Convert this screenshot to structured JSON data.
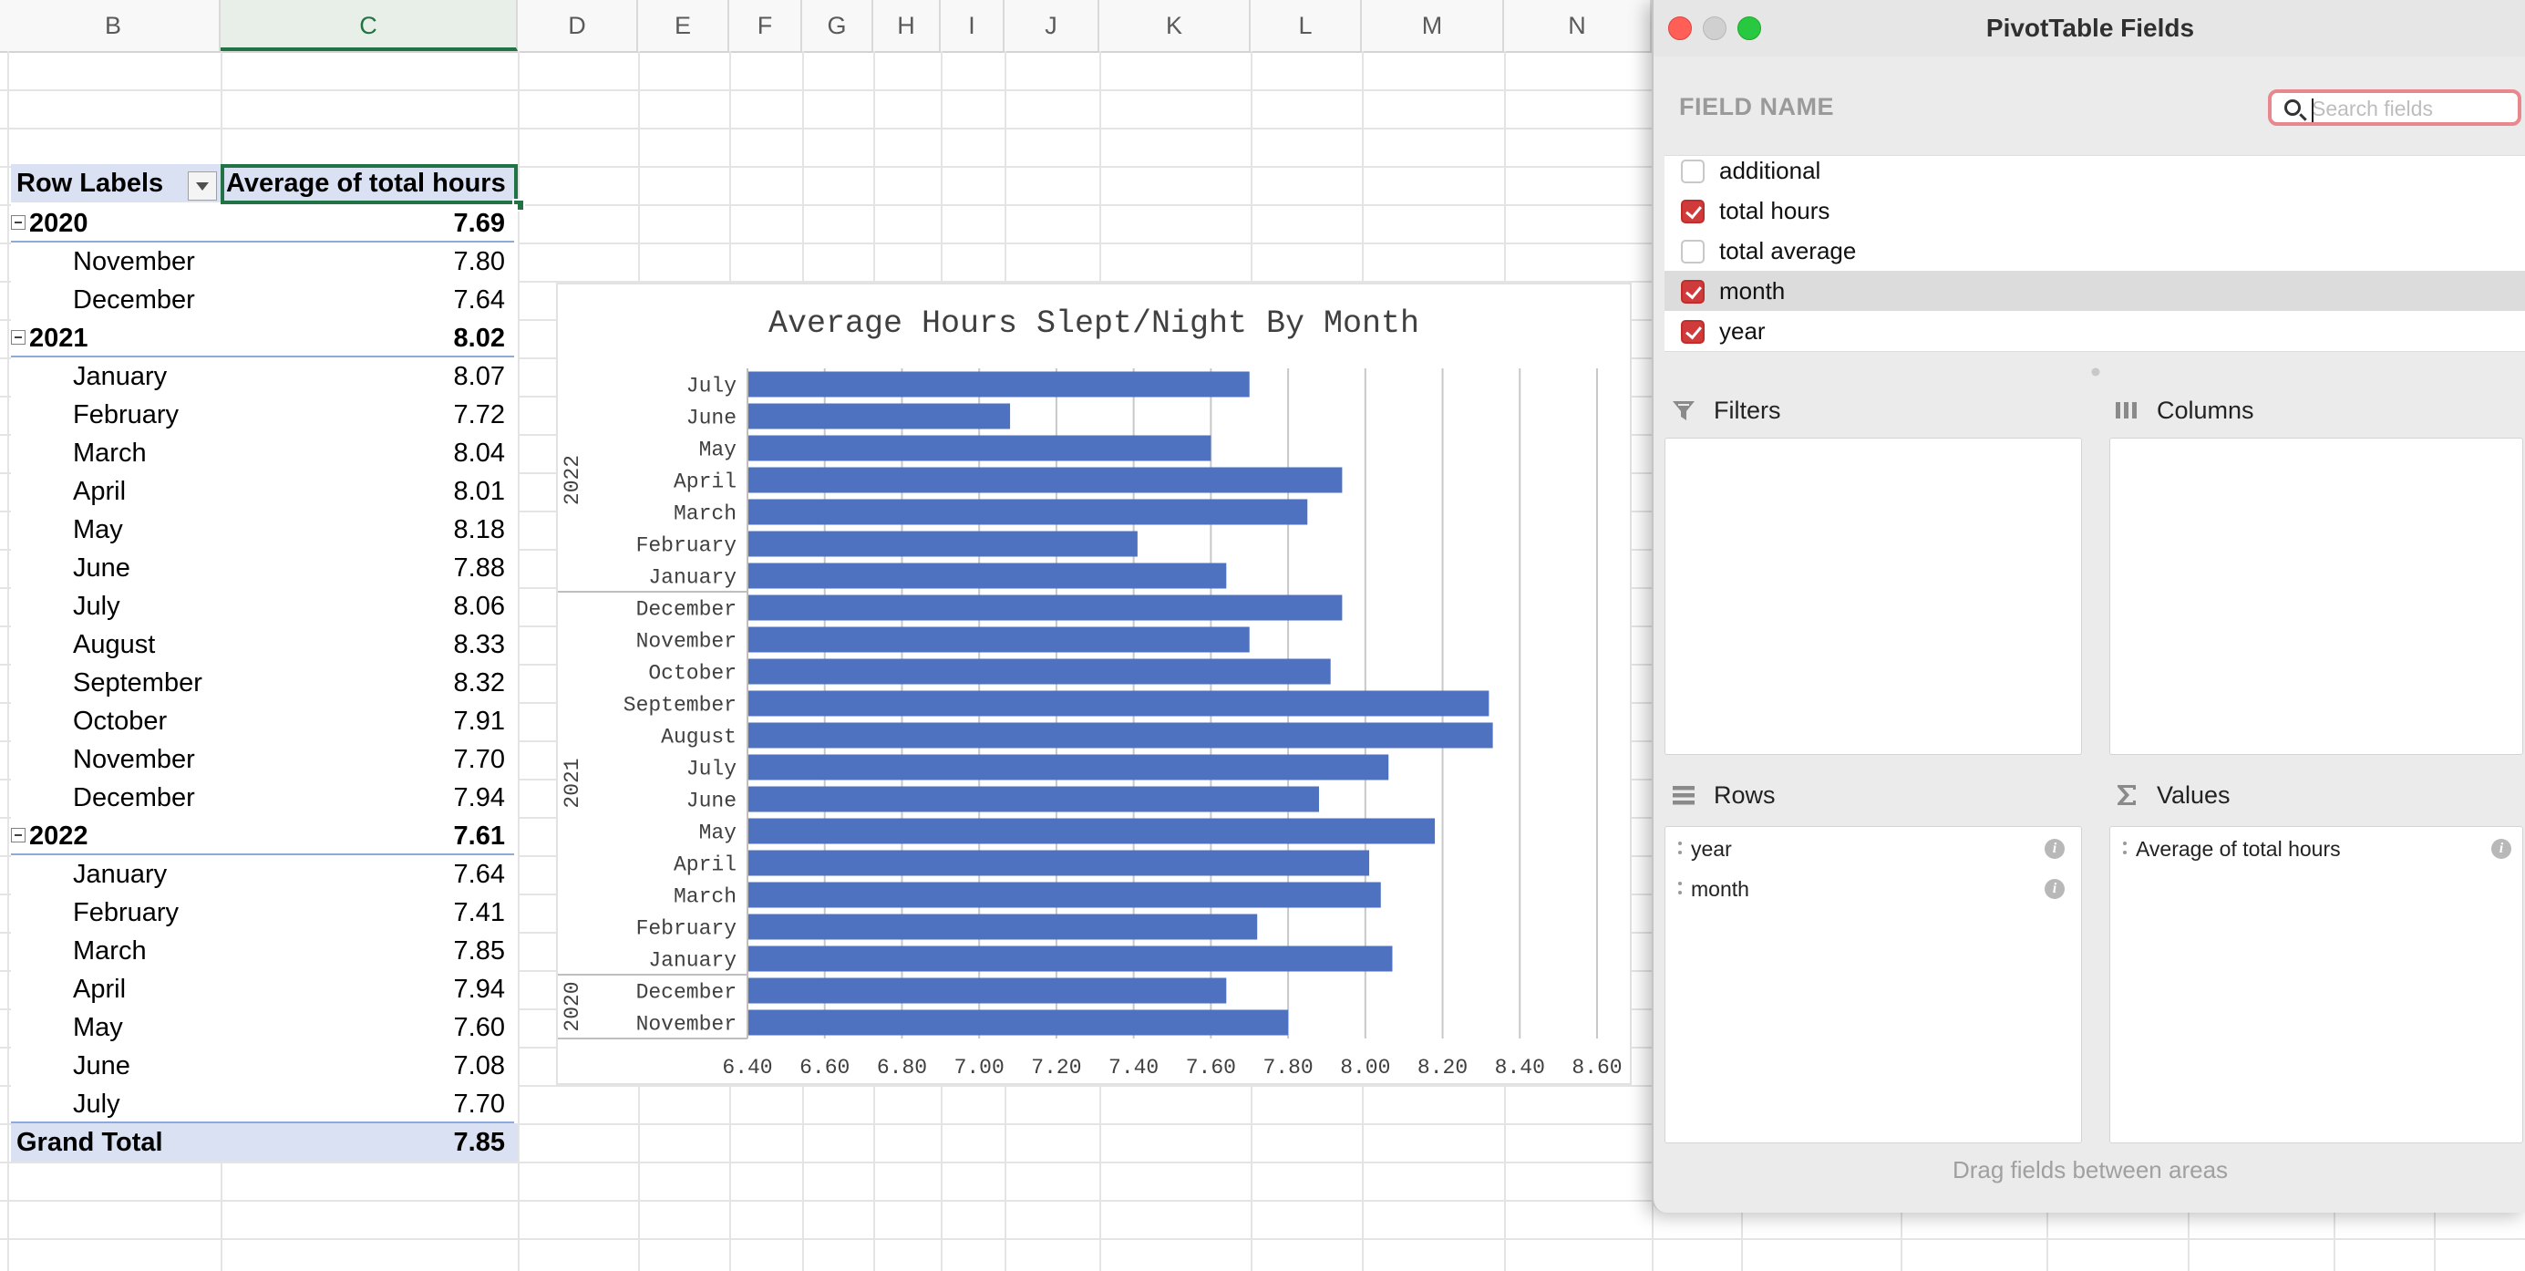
{
  "columns": [
    "B",
    "C",
    "D",
    "E",
    "F",
    "G",
    "H",
    "I",
    "J",
    "K",
    "L",
    "M",
    "N"
  ],
  "selected_column": "C",
  "pivot": {
    "header_label": "Row Labels",
    "header_value": "Average of total hours",
    "rows": [
      {
        "level": "year",
        "label": "2020",
        "value": "7.69"
      },
      {
        "level": "month",
        "label": "November",
        "value": "7.80"
      },
      {
        "level": "month",
        "label": "December",
        "value": "7.64"
      },
      {
        "level": "year",
        "label": "2021",
        "value": "8.02"
      },
      {
        "level": "month",
        "label": "January",
        "value": "8.07"
      },
      {
        "level": "month",
        "label": "February",
        "value": "7.72"
      },
      {
        "level": "month",
        "label": "March",
        "value": "8.04"
      },
      {
        "level": "month",
        "label": "April",
        "value": "8.01"
      },
      {
        "level": "month",
        "label": "May",
        "value": "8.18"
      },
      {
        "level": "month",
        "label": "June",
        "value": "7.88"
      },
      {
        "level": "month",
        "label": "July",
        "value": "8.06"
      },
      {
        "level": "month",
        "label": "August",
        "value": "8.33"
      },
      {
        "level": "month",
        "label": "September",
        "value": "8.32"
      },
      {
        "level": "month",
        "label": "October",
        "value": "7.91"
      },
      {
        "level": "month",
        "label": "November",
        "value": "7.70"
      },
      {
        "level": "month",
        "label": "December",
        "value": "7.94"
      },
      {
        "level": "year",
        "label": "2022",
        "value": "7.61"
      },
      {
        "level": "month",
        "label": "January",
        "value": "7.64"
      },
      {
        "level": "month",
        "label": "February",
        "value": "7.41"
      },
      {
        "level": "month",
        "label": "March",
        "value": "7.85"
      },
      {
        "level": "month",
        "label": "April",
        "value": "7.94"
      },
      {
        "level": "month",
        "label": "May",
        "value": "7.60"
      },
      {
        "level": "month",
        "label": "June",
        "value": "7.08"
      },
      {
        "level": "month",
        "label": "July",
        "value": "7.70"
      }
    ],
    "grand_total_label": "Grand Total",
    "grand_total_value": "7.85"
  },
  "chart_data": {
    "type": "bar",
    "orientation": "horizontal",
    "title": "Average Hours Slept/Night By Month",
    "xlim": [
      6.4,
      8.6
    ],
    "x_ticks": [
      "6.40",
      "6.60",
      "6.80",
      "7.00",
      "7.20",
      "7.40",
      "7.60",
      "7.80",
      "8.00",
      "8.20",
      "8.40",
      "8.60"
    ],
    "grid": true,
    "bar_color": "#4e71c0",
    "groups": [
      {
        "name": "2022",
        "categories": [
          "July",
          "June",
          "May",
          "April",
          "March",
          "February",
          "January"
        ],
        "values": [
          7.7,
          7.08,
          7.6,
          7.94,
          7.85,
          7.41,
          7.64
        ]
      },
      {
        "name": "2021",
        "categories": [
          "December",
          "November",
          "October",
          "September",
          "August",
          "July",
          "June",
          "May",
          "April",
          "March",
          "February",
          "January"
        ],
        "values": [
          7.94,
          7.7,
          7.91,
          8.32,
          8.33,
          8.06,
          7.88,
          8.18,
          8.01,
          8.04,
          7.72,
          8.07
        ]
      },
      {
        "name": "2020",
        "categories": [
          "December",
          "November"
        ],
        "values": [
          7.64,
          7.8
        ]
      }
    ]
  },
  "panel": {
    "title": "PivotTable Fields",
    "field_name_label": "FIELD NAME",
    "search_placeholder": "Search fields",
    "fields": [
      {
        "label": "additional",
        "checked": false
      },
      {
        "label": "total hours",
        "checked": true
      },
      {
        "label": "total average",
        "checked": false
      },
      {
        "label": "month",
        "checked": true
      },
      {
        "label": "year",
        "checked": true
      }
    ],
    "areas": {
      "filters": {
        "label": "Filters",
        "items": []
      },
      "columns": {
        "label": "Columns",
        "items": []
      },
      "rows": {
        "label": "Rows",
        "items": [
          "year",
          "month"
        ]
      },
      "values": {
        "label": "Values",
        "items": [
          "Average of total hours"
        ]
      }
    },
    "drag_hint": "Drag fields between areas"
  }
}
